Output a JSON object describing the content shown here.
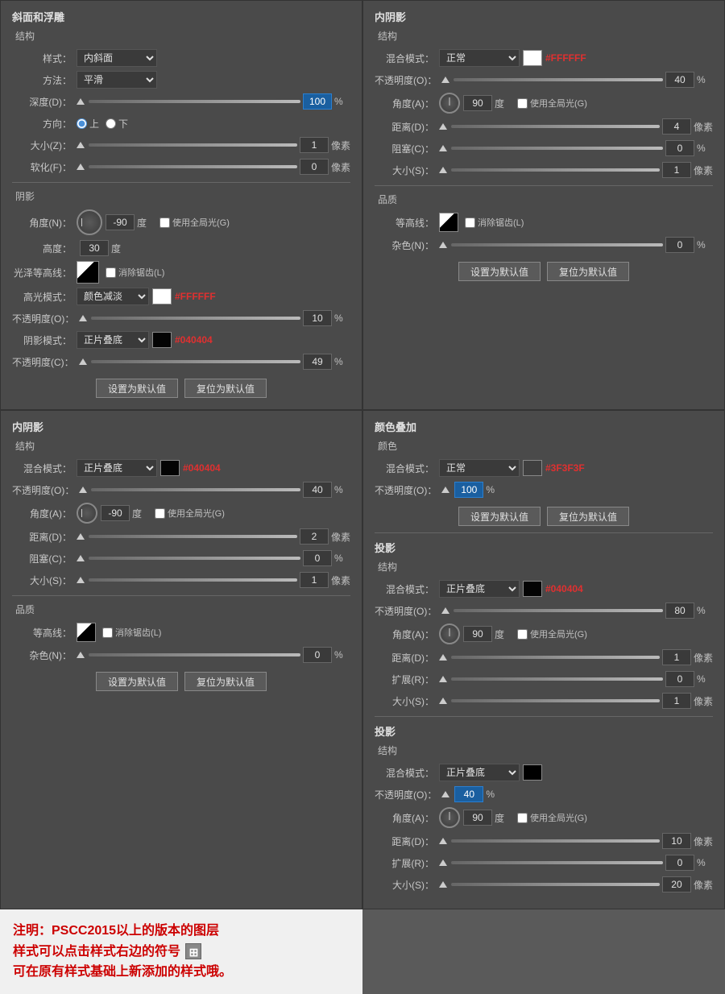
{
  "topLeft": {
    "title": "斜面和浮雕",
    "section1": "结构",
    "styleLabel": "样式：",
    "styleValue": "内斜面",
    "methodLabel": "方法：",
    "methodValue": "平滑",
    "depthLabel": "深度(D)：",
    "depthValue": "100",
    "depthUnit": "%",
    "directionLabel": "方向：",
    "dirUp": "上",
    "dirDown": "下",
    "sizeLabel": "大小(Z)：",
    "sizeValue": "1",
    "sizeUnit": "像素",
    "softenLabel": "软化(F)：",
    "softenValue": "0",
    "softenUnit": "像素",
    "section2": "阴影",
    "angleLabel": "角度(N)：",
    "angleValue": "-90",
    "angleDeg": "度",
    "useGlobalLight": "使用全局光(G)",
    "altitudeLabel": "高度：",
    "altitudeValue": "30",
    "altDeg": "度",
    "glossLabel": "光泽等高线：",
    "eliminateLabel": "消除锯齿(L)",
    "highlightLabel": "高光模式：",
    "highlightMode": "颜色减淡",
    "highlightColorHex": "#FFFFFF",
    "highlightColor": "#ffffff",
    "hlOpacityLabel": "不透明度(O)：",
    "hlOpacityValue": "10",
    "hlOpacityUnit": "%",
    "shadowModeLabel": "阴影模式：",
    "shadowMode": "正片叠底",
    "shadowColorHex": "#040404",
    "shadowColor": "#040404",
    "shadowOpacityLabel": "不透明度(C)：",
    "shadowOpacityValue": "49",
    "shadowOpacityUnit": "%",
    "setDefaultBtn": "设置为默认值",
    "resetDefaultBtn": "复位为默认值"
  },
  "topRight": {
    "title": "内阴影",
    "section1": "结构",
    "blendModeLabel": "混合模式：",
    "blendModeValue": "正常",
    "blendColorHex": "#FFFFFF",
    "blendColor": "#ffffff",
    "opacityLabel": "不透明度(O)：",
    "opacityValue": "40",
    "opacityUnit": "%",
    "angleLabel": "角度(A)：",
    "angleValue": "90",
    "angleDeg": "度",
    "useGlobalLight": "使用全局光(G)",
    "distanceLabel": "距离(D)：",
    "distanceValue": "4",
    "distanceUnit": "像素",
    "chokeLabel": "阻塞(C)：",
    "chokeValue": "0",
    "chokeUnit": "%",
    "sizeLabel": "大小(S)：",
    "sizeValue": "1",
    "sizeUnit": "像素",
    "section2": "品质",
    "contourLabel": "等高线：",
    "eliminateLabel": "消除锯齿(L)",
    "noiseLabel": "杂色(N)：",
    "noiseValue": "0",
    "noiseUnit": "%",
    "setDefaultBtn": "设置为默认值",
    "resetDefaultBtn": "复位为默认值"
  },
  "bottomLeft": {
    "title": "内阴影",
    "section1": "结构",
    "blendModeLabel": "混合模式：",
    "blendModeValue": "正片叠底",
    "blendColorHex": "#040404",
    "blendColor": "#040404",
    "opacityLabel": "不透明度(O)：",
    "opacityValue": "40",
    "opacityUnit": "%",
    "angleLabel": "角度(A)：",
    "angleValue": "-90",
    "angleDeg": "度",
    "useGlobalLight": "使用全局光(G)",
    "distanceLabel": "距离(D)：",
    "distanceValue": "2",
    "distanceUnit": "像素",
    "chokeLabel": "阻塞(C)：",
    "chokeValue": "0",
    "chokeUnit": "%",
    "sizeLabel": "大小(S)：",
    "sizeValue": "1",
    "sizeUnit": "像素",
    "section2": "品质",
    "contourLabel": "等高线：",
    "eliminateLabel": "消除锯齿(L)",
    "noiseLabel": "杂色(N)：",
    "noiseValue": "0",
    "noiseUnit": "%",
    "setDefaultBtn": "设置为默认值",
    "resetDefaultBtn": "复位为默认值"
  },
  "bottomRight": {
    "title1": "颜色叠加",
    "section1": "颜色",
    "blendModeLabel": "混合模式：",
    "blendModeValue": "正常",
    "blendColorHex": "#3F3F3F",
    "blendColor": "#3f3f3f",
    "opacityLabel": "不透明度(O)：",
    "opacityValue": "100",
    "opacityUnit": "%",
    "setDefaultBtn1": "设置为默认值",
    "resetDefaultBtn1": "复位为默认值",
    "title2": "投影",
    "section2": "结构",
    "shadowBlendLabel": "混合模式：",
    "shadowBlendValue": "正片叠底",
    "shadowColorHex": "#040404",
    "shadowColor": "#040404",
    "shadowOpacityLabel": "不透明度(O)：",
    "shadowOpacityValue": "80",
    "shadowOpacityUnit": "%",
    "angleLabel": "角度(A)：",
    "angleValue": "90",
    "angleDeg": "度",
    "useGlobalLight": "使用全局光(G)",
    "distanceLabel": "距离(D)：",
    "distanceValue": "1",
    "distanceUnit": "像素",
    "spreadLabel": "扩展(R)：",
    "spreadValue": "0",
    "spreadUnit": "%",
    "sizeLabel": "大小(S)：",
    "sizeValue": "1",
    "sizeUnit": "像素",
    "title3": "投影",
    "section3": "结构",
    "shadowBlendLabel2": "混合模式：",
    "shadowBlendValue2": "正片叠底",
    "shadowColor2": "#000000",
    "shadowOpacityLabel2": "不透明度(O)：",
    "shadowOpacityValue2": "40",
    "shadowOpacityUnit2": "%",
    "angleLabel2": "角度(A)：",
    "angleValue2": "90",
    "angleDeg2": "度",
    "useGlobalLight2": "使用全局光(G)",
    "distanceLabel2": "距离(D)：",
    "distanceValue2": "10",
    "distanceUnit2": "像素",
    "spreadLabel2": "扩展(R)：",
    "spreadValue2": "0",
    "spreadUnit2": "%",
    "sizeLabel2": "大小(S)：",
    "sizeValue2": "20",
    "sizeUnit2": "像素"
  },
  "bottomNote": {
    "line1": "注明：PSCC2015以上的版本的图层",
    "line2": "样式可以点击样式右边的符号",
    "line3": "可在原有样式基础上新添加的样式哦。"
  }
}
